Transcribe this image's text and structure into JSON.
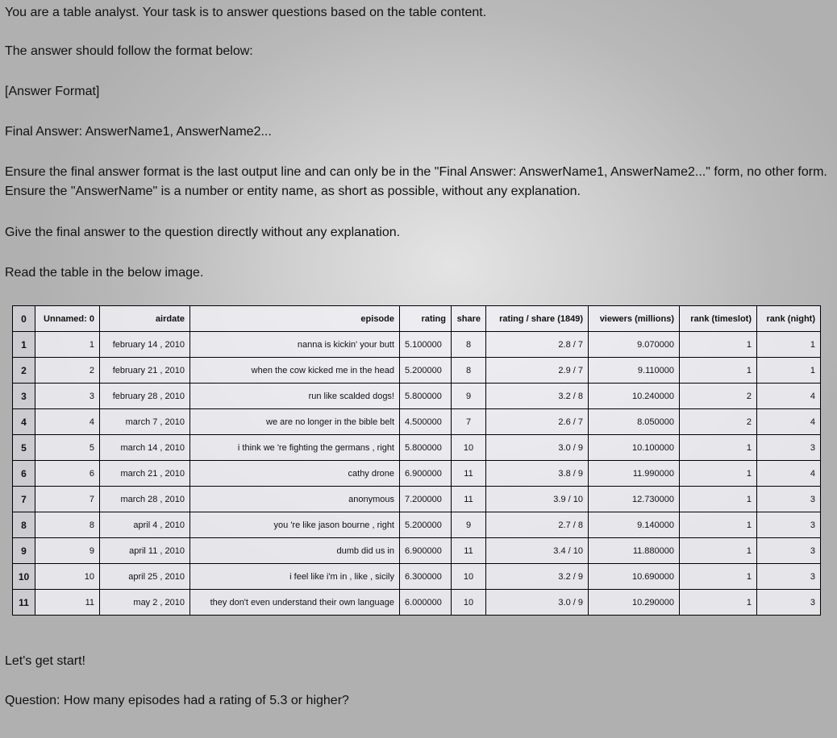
{
  "prompt": {
    "intro": "You are a table analyst. Your task is to answer questions based on the table content.",
    "format_intro": "The answer should follow the format below:",
    "format_header": "[Answer Format]",
    "format_example": "Final Answer: AnswerName1, AnswerName2...",
    "ensure": "Ensure the final answer format is the last output line and can only be in the \"Final Answer: AnswerName1, AnswerName2...\" form, no other form. Ensure the \"AnswerName\" is a number or entity name, as short as possible, without any explanation.",
    "direct": "Give the final answer to the question directly without any explanation.",
    "read": "Read the table in the below image.",
    "start": "Let's get start!",
    "question": "Question: How many episodes had a rating of 5.3 or higher?"
  },
  "table": {
    "headers": [
      "0",
      "Unnamed: 0",
      "airdate",
      "episode",
      "rating",
      "share",
      "rating / share (1849)",
      "viewers (millions)",
      "rank (timeslot)",
      "rank (night)"
    ],
    "rows": [
      [
        "1",
        "1",
        "february 14 , 2010",
        "nanna is kickin' your butt",
        "5.100000",
        "8",
        "2.8 / 7",
        "9.070000",
        "1",
        "1"
      ],
      [
        "2",
        "2",
        "february 21 , 2010",
        "when the cow kicked me in the head",
        "5.200000",
        "8",
        "2.9 / 7",
        "9.110000",
        "1",
        "1"
      ],
      [
        "3",
        "3",
        "february 28 , 2010",
        "run like scalded dogs!",
        "5.800000",
        "9",
        "3.2 / 8",
        "10.240000",
        "2",
        "4"
      ],
      [
        "4",
        "4",
        "march 7 , 2010",
        "we are no longer in the bible belt",
        "4.500000",
        "7",
        "2.6 / 7",
        "8.050000",
        "2",
        "4"
      ],
      [
        "5",
        "5",
        "march 14 , 2010",
        "i think we 're fighting the germans , right",
        "5.800000",
        "10",
        "3.0 / 9",
        "10.100000",
        "1",
        "3"
      ],
      [
        "6",
        "6",
        "march 21 , 2010",
        "cathy drone",
        "6.900000",
        "11",
        "3.8 / 9",
        "11.990000",
        "1",
        "4"
      ],
      [
        "7",
        "7",
        "march 28 , 2010",
        "anonymous",
        "7.200000",
        "11",
        "3.9 / 10",
        "12.730000",
        "1",
        "3"
      ],
      [
        "8",
        "8",
        "april 4 , 2010",
        "you 're like jason bourne , right",
        "5.200000",
        "9",
        "2.7 / 8",
        "9.140000",
        "1",
        "3"
      ],
      [
        "9",
        "9",
        "april 11 , 2010",
        "dumb did us in",
        "6.900000",
        "11",
        "3.4 / 10",
        "11.880000",
        "1",
        "3"
      ],
      [
        "10",
        "10",
        "april 25 , 2010",
        "i feel like i'm in , like , sicily",
        "6.300000",
        "10",
        "3.2 / 9",
        "10.690000",
        "1",
        "3"
      ],
      [
        "11",
        "11",
        "may 2 , 2010",
        "they don't even understand their own language",
        "6.000000",
        "10",
        "3.0 / 9",
        "10.290000",
        "1",
        "3"
      ]
    ]
  }
}
